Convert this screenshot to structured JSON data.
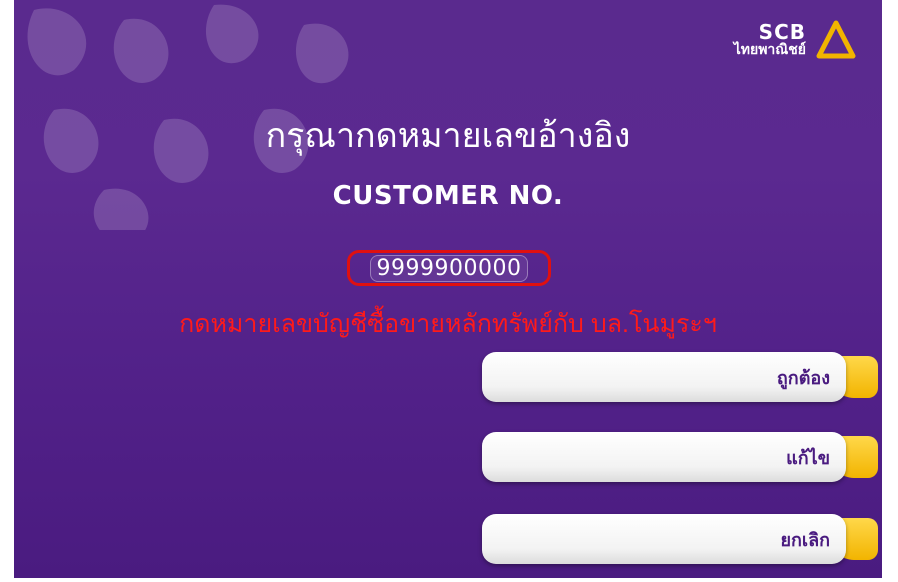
{
  "logo": {
    "brand": "SCB",
    "subtitle": "ไทยพาณิชย์",
    "icon": "scb-logo-icon"
  },
  "header": {
    "title_thai": "กรุณากดหมายเลขอ้างอิง",
    "title_english": "CUSTOMER NO."
  },
  "input": {
    "value": "9999900000"
  },
  "hint": {
    "text": "กดหมายเลขบัญชีซื้อขายหลักทรัพย์กับ บล.โนมูระฯ"
  },
  "buttons": [
    {
      "label": "ถูกต้อง"
    },
    {
      "label": "แก้ไข"
    },
    {
      "label": "ยกเลิก"
    }
  ],
  "colors": {
    "background": "#5a2a8e",
    "accent": "#f2b400",
    "highlight": "#e01010"
  }
}
